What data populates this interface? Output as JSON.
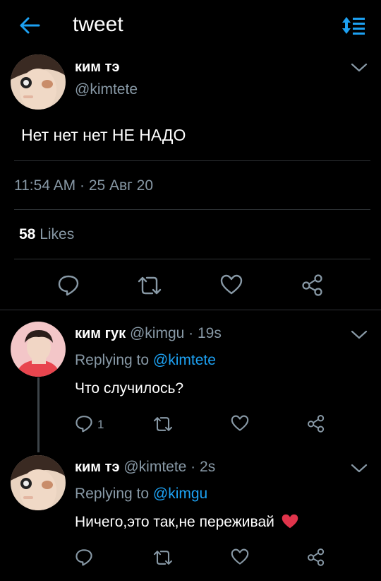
{
  "header": {
    "title": "tweet",
    "back_icon": "arrow-left-icon",
    "sort_icon": "sort-icon",
    "accent": "#1da1f2"
  },
  "main_tweet": {
    "author_name": "ким тэ",
    "handle": "@kimtete",
    "text": "Нет нет нет НЕ НАДО",
    "timestamp": "11:54 AM · 25 Авг 20",
    "likes_count": "58",
    "likes_label": "Likes"
  },
  "replies": [
    {
      "author_name": "ким гук",
      "handle_time": "@kimgu · 19s",
      "replying_prefix": "Replying to",
      "replying_to": "@kimtete",
      "text": "Что случилось?",
      "reply_count": "1"
    },
    {
      "author_name": "ким тэ",
      "handle_time": "@kimtete · 2s",
      "replying_prefix": "Replying to",
      "replying_to": "@kimgu",
      "text": "Ничего,это так,не переживай"
    }
  ],
  "colors": {
    "background": "#000000",
    "secondary_text": "#8899a6",
    "divider": "#2f3336",
    "heart_emoji": "#e0344b"
  }
}
